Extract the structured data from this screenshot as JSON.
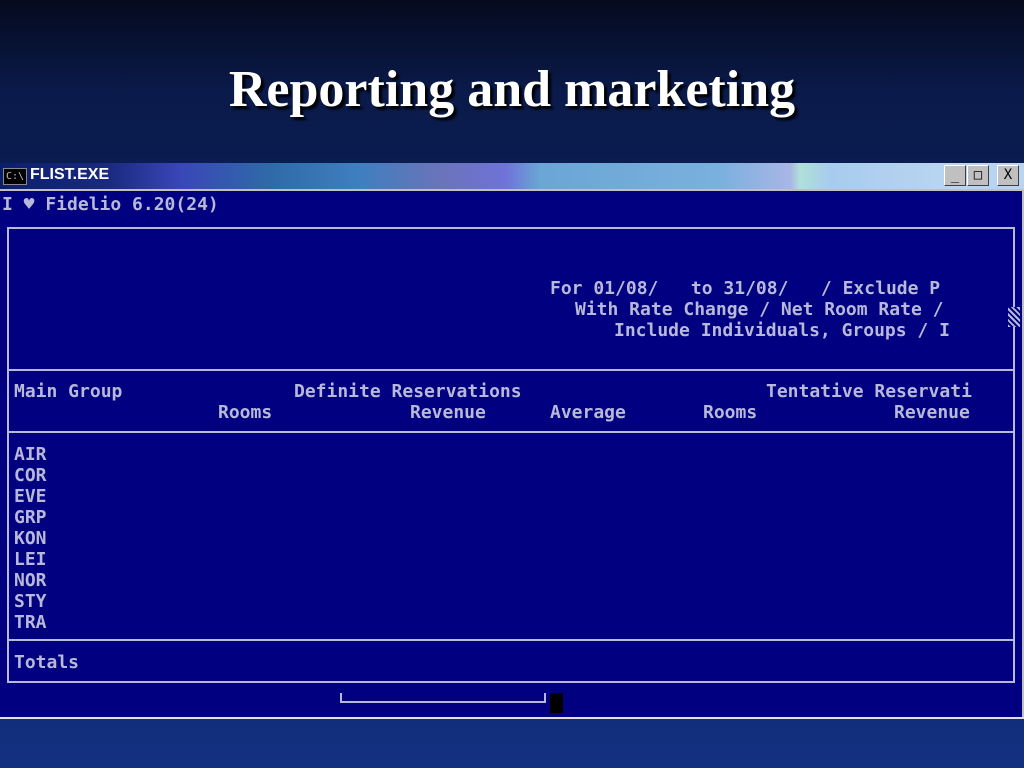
{
  "slide": {
    "title": "Reporting and marketing"
  },
  "window": {
    "icon_text": "C:\\",
    "title": "FLIST.EXE",
    "minimize": "_",
    "maximize": "□",
    "close": "X"
  },
  "console": {
    "status_line": "I ♥ Fidelio 6.20(24)",
    "filter_lines": [
      "For 01/08/   to 31/08/   / Exclude P",
      "With Rate Change / Net Room Rate /",
      "Include Individuals, Groups / I"
    ],
    "headers": {
      "main_group": "Main Group",
      "definite": "Definite Reservations",
      "tentative": "Tentative Reservati",
      "rooms": "Rooms",
      "revenue": "Revenue",
      "average": "Average",
      "rooms2": "Rooms",
      "revenue2": "Revenue"
    },
    "groups": [
      "AIR",
      "COR",
      "EVE",
      "GRP",
      "KON",
      "LEI",
      "NOR",
      "STY",
      "TRA"
    ],
    "totals_label": "Totals",
    "input_value": ""
  }
}
